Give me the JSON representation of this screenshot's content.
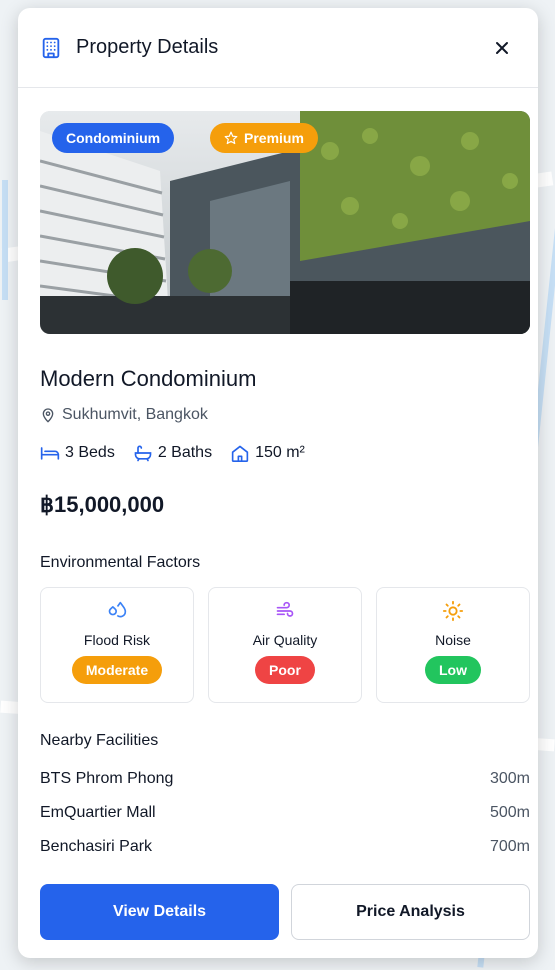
{
  "header": {
    "title": "Property Details",
    "icon": "building-icon",
    "close_icon": "close-icon"
  },
  "property": {
    "category_badge": "Condominium",
    "premium_badge": "Premium",
    "name": "Modern Condominium",
    "location": "Sukhumvit, Bangkok",
    "beds": "3 Beds",
    "baths": "2 Baths",
    "area": "150 m²",
    "price": "฿15,000,000"
  },
  "environment": {
    "title": "Environmental Factors",
    "factors": [
      {
        "label": "Flood Risk",
        "status": "Moderate",
        "icon": "droplets-icon",
        "icon_color": "#3b82f6",
        "status_color": "#f59e0b"
      },
      {
        "label": "Air Quality",
        "status": "Poor",
        "icon": "wind-icon",
        "icon_color": "#a855f7",
        "status_color": "#ef4444"
      },
      {
        "label": "Noise",
        "status": "Low",
        "icon": "sun-icon",
        "icon_color": "#f59e0b",
        "status_color": "#22c55e"
      }
    ]
  },
  "nearby": {
    "title": "Nearby Facilities",
    "items": [
      {
        "name": "BTS Phrom Phong",
        "distance": "300m"
      },
      {
        "name": "EmQuartier Mall",
        "distance": "500m"
      },
      {
        "name": "Benchasiri Park",
        "distance": "700m"
      }
    ]
  },
  "actions": {
    "view_details": "View Details",
    "price_analysis": "Price Analysis"
  },
  "colors": {
    "primary": "#2563eb",
    "premium": "#f59e0b"
  }
}
